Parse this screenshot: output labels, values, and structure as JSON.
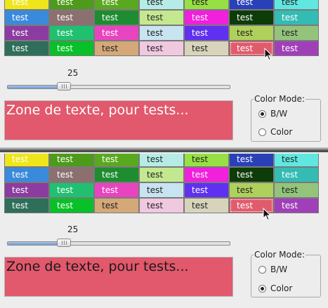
{
  "cell_text": "test",
  "grid_rows": [
    [
      {
        "c": "#eee61a",
        "d": false
      },
      {
        "c": "#4e9a1a",
        "d": false
      },
      {
        "c": "#5aa820",
        "d": false
      },
      {
        "c": "#b6ece6",
        "d": true
      },
      {
        "c": "#96e044",
        "d": true
      },
      {
        "c": "#2a40b8",
        "d": false
      },
      {
        "c": "#60e8e0",
        "d": true
      }
    ],
    [
      {
        "c": "#3a8adc",
        "d": false
      },
      {
        "c": "#8c7070",
        "d": false
      },
      {
        "c": "#1e8c30",
        "d": false
      },
      {
        "c": "#c4e890",
        "d": true
      },
      {
        "c": "#f020dc",
        "d": false
      },
      {
        "c": "#0e3c08",
        "d": false
      },
      {
        "c": "#34bcb4",
        "d": false
      }
    ],
    [
      {
        "c": "#8c3ca0",
        "d": false
      },
      {
        "c": "#20c070",
        "d": false
      },
      {
        "c": "#e844c0",
        "d": false
      },
      {
        "c": "#c8e4f0",
        "d": true
      },
      {
        "c": "#6030f0",
        "d": false
      },
      {
        "c": "#b0d05c",
        "d": true
      },
      {
        "c": "#94c47c",
        "d": true
      }
    ],
    [
      {
        "c": "#2e6e5a",
        "d": false
      },
      {
        "c": "#08c028",
        "d": false
      },
      {
        "c": "#d4a878",
        "d": true
      },
      {
        "c": "#f0c8e0",
        "d": true
      },
      {
        "c": "#d8d4bc",
        "d": true
      },
      {
        "c": "#e05c6c",
        "d": false,
        "sel": true
      },
      {
        "c": "#a040b8",
        "d": false
      }
    ]
  ],
  "panels": [
    {
      "slider_value": "25",
      "slider_fraction": 0.25,
      "text_field": "Zone de texte, pour tests...",
      "text_color": "white",
      "color_mode_title": "Color Mode:",
      "mode_options": [
        "B/W",
        "Color"
      ],
      "selected_mode": "B/W"
    },
    {
      "slider_value": "25",
      "slider_fraction": 0.25,
      "text_field": "Zone de texte, pour tests...",
      "text_color": "black",
      "color_mode_title": "Color Mode:",
      "mode_options": [
        "B/W",
        "Color"
      ],
      "selected_mode": "Color"
    }
  ]
}
